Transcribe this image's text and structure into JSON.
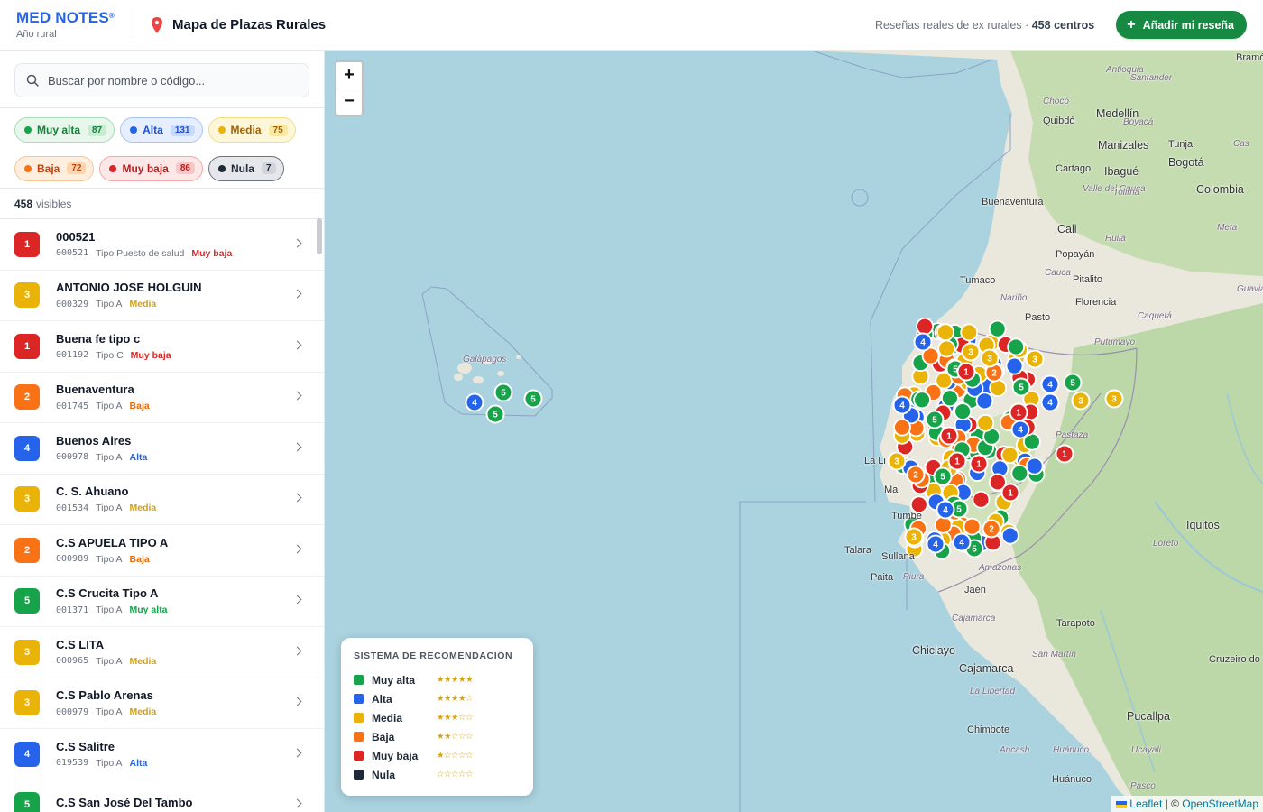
{
  "header": {
    "brand": "MED NOTES",
    "brand_mark": "®",
    "brand_subtitle": "Año rural",
    "title": "Mapa de Plazas Rurales",
    "stats_text": "Reseñas reales de ex rurales · ",
    "stats_count": "458 centros",
    "add_button": "Añadir mi reseña"
  },
  "search": {
    "placeholder": "Buscar por nombre o código..."
  },
  "filters": [
    {
      "label": "Muy alta",
      "count": "87",
      "color": "#16a34a"
    },
    {
      "label": "Alta",
      "count": "131",
      "color": "#2563eb"
    },
    {
      "label": "Media",
      "count": "75",
      "color": "#eab308"
    },
    {
      "label": "Baja",
      "count": "72",
      "color": "#f97316"
    },
    {
      "label": "Muy baja",
      "count": "86",
      "color": "#dc2626"
    },
    {
      "label": "Nula",
      "count": "7",
      "color": "#1f2937"
    }
  ],
  "visible": {
    "count": "458",
    "label": "visibles"
  },
  "centers": [
    {
      "score": "1",
      "name": "000521",
      "code": "000521",
      "type": "Tipo Puesto de salud",
      "level": "Muy baja"
    },
    {
      "score": "3",
      "name": "ANTONIO JOSE HOLGUIN",
      "code": "000329",
      "type": "Tipo A",
      "level": "Media"
    },
    {
      "score": "1",
      "name": "Buena fe tipo c",
      "code": "001192",
      "type": "Tipo C",
      "level": "Muy baja"
    },
    {
      "score": "2",
      "name": "Buenaventura",
      "code": "001745",
      "type": "Tipo A",
      "level": "Baja"
    },
    {
      "score": "4",
      "name": "Buenos Aires",
      "code": "000978",
      "type": "Tipo A",
      "level": "Alta"
    },
    {
      "score": "3",
      "name": "C. S. Ahuano",
      "code": "001534",
      "type": "Tipo A",
      "level": "Media"
    },
    {
      "score": "2",
      "name": "C.S APUELA TIPO A",
      "code": "000989",
      "type": "Tipo A",
      "level": "Baja"
    },
    {
      "score": "5",
      "name": "C.S Crucita Tipo A",
      "code": "001371",
      "type": "Tipo A",
      "level": "Muy alta"
    },
    {
      "score": "3",
      "name": "C.S LITA",
      "code": "000965",
      "type": "Tipo A",
      "level": "Media"
    },
    {
      "score": "3",
      "name": "C.S Pablo Arenas",
      "code": "000979",
      "type": "Tipo A",
      "level": "Media"
    },
    {
      "score": "4",
      "name": "C.S Salitre",
      "code": "019539",
      "type": "Tipo A",
      "level": "Alta"
    },
    {
      "score": "5",
      "name": "C.S San José Del Tambo",
      "code": "",
      "type": "",
      "level": ""
    }
  ],
  "legend": {
    "title": "SISTEMA DE RECOMENDACIÓN",
    "items": [
      {
        "label": "Muy alta",
        "stars": "★★★★★",
        "color": "#16a34a"
      },
      {
        "label": "Alta",
        "stars": "★★★★☆",
        "color": "#2563eb"
      },
      {
        "label": "Media",
        "stars": "★★★☆☆",
        "color": "#eab308"
      },
      {
        "label": "Baja",
        "stars": "★★☆☆☆",
        "color": "#f97316"
      },
      {
        "label": "Muy baja",
        "stars": "★☆☆☆☆",
        "color": "#dc2626"
      },
      {
        "label": "Nula",
        "stars": "☆☆☆☆☆",
        "color": "#1f2937"
      }
    ]
  },
  "map": {
    "zoom_in": "+",
    "zoom_out": "−",
    "attribution_leaflet": "Leaflet",
    "attribution_sep": " | © ",
    "attribution_osm": "OpenStreetMap",
    "labels": [
      {
        "text": "Bramón",
        "kind": "place"
      },
      {
        "text": "Antioquia",
        "kind": "region"
      },
      {
        "text": "Santander",
        "kind": "region"
      },
      {
        "text": "Chocó",
        "kind": "region"
      },
      {
        "text": "Medellín",
        "kind": "city"
      },
      {
        "text": "Quibdó",
        "kind": "place"
      },
      {
        "text": "Boyacá",
        "kind": "region"
      },
      {
        "text": "Manizales",
        "kind": "city"
      },
      {
        "text": "Tunja",
        "kind": "place"
      },
      {
        "text": "Cas",
        "kind": "region"
      },
      {
        "text": "Cartago",
        "kind": "place"
      },
      {
        "text": "Ibagué",
        "kind": "city"
      },
      {
        "text": "Bogotá",
        "kind": "city"
      },
      {
        "text": "Valle del Cauca",
        "kind": "region"
      },
      {
        "text": "Tolima",
        "kind": "region"
      },
      {
        "text": "Colombia",
        "kind": "city"
      },
      {
        "text": "Buenaventura",
        "kind": "place"
      },
      {
        "text": "Cali",
        "kind": "city"
      },
      {
        "text": "Meta",
        "kind": "region"
      },
      {
        "text": "Huila",
        "kind": "region"
      },
      {
        "text": "Popayán",
        "kind": "place"
      },
      {
        "text": "Cauca",
        "kind": "region"
      },
      {
        "text": "Pitalito",
        "kind": "place"
      },
      {
        "text": "Tumaco",
        "kind": "place"
      },
      {
        "text": "Guaviare",
        "kind": "region"
      },
      {
        "text": "Nariño",
        "kind": "region"
      },
      {
        "text": "Florencia",
        "kind": "place"
      },
      {
        "text": "Pasto",
        "kind": "place"
      },
      {
        "text": "Caquetá",
        "kind": "region"
      },
      {
        "text": "Putumayo",
        "kind": "region"
      },
      {
        "text": "Galápagos",
        "kind": "region"
      },
      {
        "text": "Pastaza",
        "kind": "region"
      },
      {
        "text": "La Li",
        "kind": "place"
      },
      {
        "text": "Ma",
        "kind": "place"
      },
      {
        "text": "Tumbe",
        "kind": "place"
      },
      {
        "text": "Iquitos",
        "kind": "city"
      },
      {
        "text": "Talara",
        "kind": "place"
      },
      {
        "text": "Sullana",
        "kind": "place"
      },
      {
        "text": "Loreto",
        "kind": "region"
      },
      {
        "text": "Paita",
        "kind": "place"
      },
      {
        "text": "Piura",
        "kind": "region"
      },
      {
        "text": "Amazonas",
        "kind": "region"
      },
      {
        "text": "Jaén",
        "kind": "place"
      },
      {
        "text": "Cajamarca",
        "kind": "region"
      },
      {
        "text": "Tarapoto",
        "kind": "place"
      },
      {
        "text": "Chiclayo",
        "kind": "city"
      },
      {
        "text": "San Martín",
        "kind": "region"
      },
      {
        "text": "Cruzeiro do Sul",
        "kind": "place"
      },
      {
        "text": "Cajamarca",
        "kind": "city"
      },
      {
        "text": "La Libertad",
        "kind": "region"
      },
      {
        "text": "Chimbote",
        "kind": "place"
      },
      {
        "text": "Pucallpa",
        "kind": "city"
      },
      {
        "text": "Ancash",
        "kind": "region"
      },
      {
        "text": "Huánuco",
        "kind": "region"
      },
      {
        "text": "Ucayali",
        "kind": "region"
      },
      {
        "text": "Huánuco",
        "kind": "place"
      },
      {
        "text": "Pasco",
        "kind": "region"
      }
    ],
    "markers": [
      {
        "score": "4"
      },
      {
        "score": "5"
      },
      {
        "score": "5"
      },
      {
        "score": "5"
      },
      {
        "score": "3"
      },
      {
        "score": "3"
      },
      {
        "score": "5"
      },
      {
        "score": "4"
      },
      {
        "score": "1"
      },
      {
        "score": "4"
      },
      {
        "score": "1"
      },
      {
        "score": "3"
      },
      {
        "score": "3"
      },
      {
        "score": "2"
      },
      {
        "score": "3"
      },
      {
        "score": "4"
      },
      {
        "score": "2"
      },
      {
        "score": "5"
      },
      {
        "score": "3"
      },
      {
        "score": "5"
      },
      {
        "score": "1"
      },
      {
        "score": "4"
      },
      {
        "score": "1"
      },
      {
        "score": "1"
      },
      {
        "score": "5"
      },
      {
        "score": "4"
      },
      {
        "score": "3"
      },
      {
        "score": "5"
      },
      {
        "score": "4"
      },
      {
        "score": "1"
      },
      {
        "score": "5"
      },
      {
        "score": "3"
      },
      {
        "score": "1"
      },
      {
        "score": "4"
      },
      {
        "score": "5"
      },
      {
        "score": "2"
      },
      {
        "score": "4"
      },
      {
        "score": "3"
      }
    ]
  }
}
